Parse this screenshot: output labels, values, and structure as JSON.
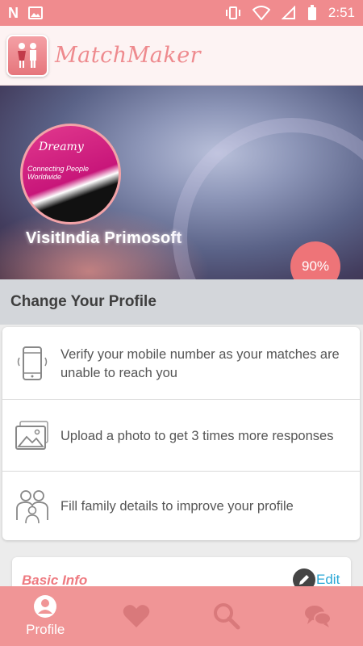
{
  "status_bar": {
    "time": "2:51",
    "left_icons": [
      "n-logo-icon",
      "image-icon"
    ],
    "right_icons": [
      "vibrate-icon",
      "wifi-icon",
      "no-sim-icon",
      "battery-icon"
    ]
  },
  "app": {
    "title": "MatchMaker",
    "logo_icon": "couple-logo-icon"
  },
  "banner": {
    "profile_name": "VisitIndia Primosoft",
    "avatar_text_1": "Dreamy",
    "avatar_text_2": "Connecting People Worldwide",
    "profile_completion": "90%"
  },
  "section": {
    "title": "Change Your Profile"
  },
  "profile_tasks": [
    {
      "icon": "mobile-phone-icon",
      "text": "Verify your mobile number as your matches are unable to reach you"
    },
    {
      "icon": "photo-icon",
      "text": "Upload a photo to get 3 times more responses"
    },
    {
      "icon": "family-icon",
      "text": "Fill family details to improve your profile"
    }
  ],
  "basic_info": {
    "title": "Basic Info",
    "edit_label": "Edit"
  },
  "bottom_nav": {
    "items": [
      {
        "label": "Profile",
        "icon": "profile-icon",
        "active": true
      },
      {
        "label": "",
        "icon": "heart-icon",
        "active": false
      },
      {
        "label": "",
        "icon": "search-icon",
        "active": false
      },
      {
        "label": "",
        "icon": "chat-icon",
        "active": false
      }
    ]
  },
  "colors": {
    "accent": "#f08b8e",
    "edit_link": "#2aa7d6",
    "section_bg": "#d3d6da"
  }
}
